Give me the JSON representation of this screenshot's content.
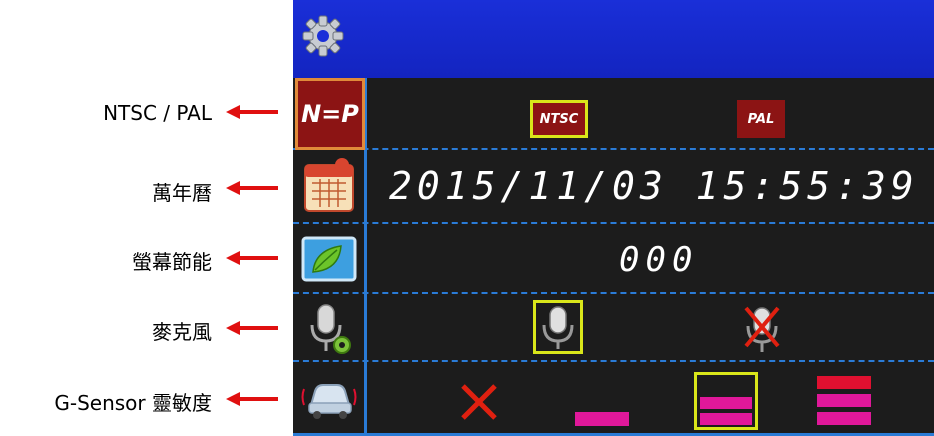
{
  "annotations": [
    {
      "label": "NTSC / PAL"
    },
    {
      "label": "萬年曆"
    },
    {
      "label": "螢幕節能"
    },
    {
      "label": "麥克風"
    },
    {
      "label": "G-Sensor 靈敏度"
    }
  ],
  "screen": {
    "video_row": {
      "icon_text": "N=P",
      "options": [
        "NTSC",
        "PAL"
      ],
      "selected": "NTSC"
    },
    "calendar_row": {
      "datetime": "2015/11/03  15:55:39"
    },
    "screensaver_row": {
      "value": "000"
    },
    "microphone_row": {
      "options": [
        "mic-on",
        "mic-off"
      ],
      "selected": "mic-on"
    },
    "gsensor_row": {
      "options": [
        "off",
        "low",
        "medium",
        "high"
      ],
      "selected": "medium"
    }
  },
  "colors": {
    "topbar": "#1a2fd8",
    "screen_bg": "#1c1c1c",
    "divider": "#2a7bd6",
    "highlight": "#d9e61a",
    "button_red": "#8c1414",
    "level_magenta": "#e0189a",
    "level_red": "#e01030",
    "off_x": "#e02010",
    "arrow": "#e01010"
  },
  "icons": [
    "gear-icon",
    "ntsc-pal-icon",
    "calendar-icon",
    "leaf-screen-icon",
    "mic-settings-icon",
    "car-vibration-icon",
    "mic-icon",
    "mic-mute-icon",
    "x-icon"
  ]
}
